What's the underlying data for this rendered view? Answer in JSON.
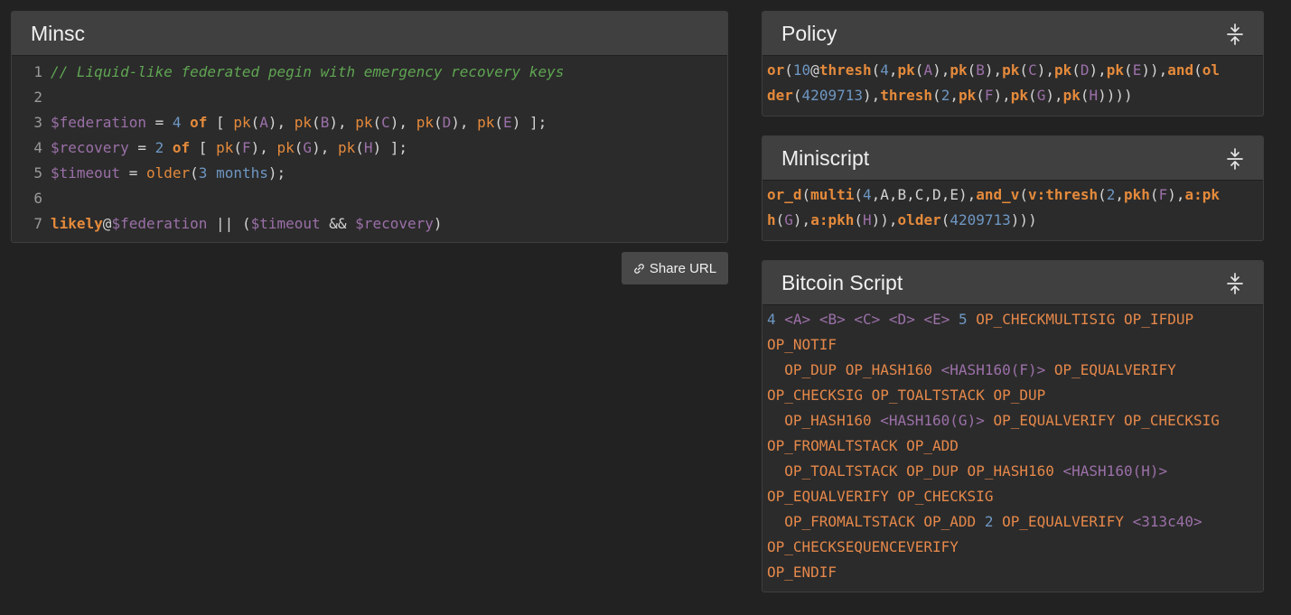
{
  "minsc": {
    "title": "Minsc",
    "lines": [
      [
        {
          "t": "// Liquid-like federated pegin with emergency recovery keys",
          "c": "c-com"
        }
      ],
      [],
      [
        {
          "t": "$federation",
          "c": "c-var"
        },
        {
          "t": " = ",
          "c": "c-punc"
        },
        {
          "t": "4",
          "c": "c-num"
        },
        {
          "t": " ",
          "c": "c-punc"
        },
        {
          "t": "of",
          "c": "c-kw"
        },
        {
          "t": " [ ",
          "c": "c-punc"
        },
        {
          "t": "pk",
          "c": "c-fn"
        },
        {
          "t": "(",
          "c": "c-punc"
        },
        {
          "t": "A",
          "c": "c-arg"
        },
        {
          "t": "), ",
          "c": "c-punc"
        },
        {
          "t": "pk",
          "c": "c-fn"
        },
        {
          "t": "(",
          "c": "c-punc"
        },
        {
          "t": "B",
          "c": "c-arg"
        },
        {
          "t": "), ",
          "c": "c-punc"
        },
        {
          "t": "pk",
          "c": "c-fn"
        },
        {
          "t": "(",
          "c": "c-punc"
        },
        {
          "t": "C",
          "c": "c-arg"
        },
        {
          "t": "), ",
          "c": "c-punc"
        },
        {
          "t": "pk",
          "c": "c-fn"
        },
        {
          "t": "(",
          "c": "c-punc"
        },
        {
          "t": "D",
          "c": "c-arg"
        },
        {
          "t": "), ",
          "c": "c-punc"
        },
        {
          "t": "pk",
          "c": "c-fn"
        },
        {
          "t": "(",
          "c": "c-punc"
        },
        {
          "t": "E",
          "c": "c-arg"
        },
        {
          "t": ") ];",
          "c": "c-punc"
        }
      ],
      [
        {
          "t": "$recovery",
          "c": "c-var"
        },
        {
          "t": " = ",
          "c": "c-punc"
        },
        {
          "t": "2",
          "c": "c-num"
        },
        {
          "t": " ",
          "c": "c-punc"
        },
        {
          "t": "of",
          "c": "c-kw"
        },
        {
          "t": " [ ",
          "c": "c-punc"
        },
        {
          "t": "pk",
          "c": "c-fn"
        },
        {
          "t": "(",
          "c": "c-punc"
        },
        {
          "t": "F",
          "c": "c-arg"
        },
        {
          "t": "), ",
          "c": "c-punc"
        },
        {
          "t": "pk",
          "c": "c-fn"
        },
        {
          "t": "(",
          "c": "c-punc"
        },
        {
          "t": "G",
          "c": "c-arg"
        },
        {
          "t": "), ",
          "c": "c-punc"
        },
        {
          "t": "pk",
          "c": "c-fn"
        },
        {
          "t": "(",
          "c": "c-punc"
        },
        {
          "t": "H",
          "c": "c-arg"
        },
        {
          "t": ") ];",
          "c": "c-punc"
        }
      ],
      [
        {
          "t": "$timeout",
          "c": "c-var"
        },
        {
          "t": " = ",
          "c": "c-punc"
        },
        {
          "t": "older",
          "c": "c-fn"
        },
        {
          "t": "(",
          "c": "c-punc"
        },
        {
          "t": "3",
          "c": "c-num"
        },
        {
          "t": " ",
          "c": "c-punc"
        },
        {
          "t": "months",
          "c": "c-num"
        },
        {
          "t": ");",
          "c": "c-punc"
        }
      ],
      [],
      [
        {
          "t": "likely",
          "c": "c-kw"
        },
        {
          "t": "@",
          "c": "c-punc"
        },
        {
          "t": "$federation",
          "c": "c-var"
        },
        {
          "t": " || (",
          "c": "c-punc"
        },
        {
          "t": "$timeout",
          "c": "c-var"
        },
        {
          "t": " && ",
          "c": "c-punc"
        },
        {
          "t": "$recovery",
          "c": "c-var"
        },
        {
          "t": ")",
          "c": "c-punc"
        }
      ]
    ]
  },
  "share_button": {
    "label": "Share URL"
  },
  "policy": {
    "title": "Policy",
    "lines": [
      [
        {
          "t": "or",
          "c": "c-fnb"
        },
        {
          "t": "(",
          "c": "c-punc"
        },
        {
          "t": "10",
          "c": "c-num"
        },
        {
          "t": "@",
          "c": "c-punc"
        },
        {
          "t": "thresh",
          "c": "c-fnb"
        },
        {
          "t": "(",
          "c": "c-punc"
        },
        {
          "t": "4",
          "c": "c-num"
        },
        {
          "t": ",",
          "c": "c-punc"
        },
        {
          "t": "pk",
          "c": "c-fnb"
        },
        {
          "t": "(",
          "c": "c-punc"
        },
        {
          "t": "A",
          "c": "c-arg"
        },
        {
          "t": "),",
          "c": "c-punc"
        },
        {
          "t": "pk",
          "c": "c-fnb"
        },
        {
          "t": "(",
          "c": "c-punc"
        },
        {
          "t": "B",
          "c": "c-arg"
        },
        {
          "t": "),",
          "c": "c-punc"
        },
        {
          "t": "pk",
          "c": "c-fnb"
        },
        {
          "t": "(",
          "c": "c-punc"
        },
        {
          "t": "C",
          "c": "c-arg"
        },
        {
          "t": "),",
          "c": "c-punc"
        },
        {
          "t": "pk",
          "c": "c-fnb"
        },
        {
          "t": "(",
          "c": "c-punc"
        },
        {
          "t": "D",
          "c": "c-arg"
        },
        {
          "t": "),",
          "c": "c-punc"
        },
        {
          "t": "pk",
          "c": "c-fnb"
        },
        {
          "t": "(",
          "c": "c-punc"
        },
        {
          "t": "E",
          "c": "c-arg"
        },
        {
          "t": ")),",
          "c": "c-punc"
        },
        {
          "t": "and",
          "c": "c-fnb"
        },
        {
          "t": "(",
          "c": "c-punc"
        },
        {
          "t": "ol",
          "c": "c-fnb"
        }
      ],
      [
        {
          "t": "der",
          "c": "c-fnb"
        },
        {
          "t": "(",
          "c": "c-punc"
        },
        {
          "t": "4209713",
          "c": "c-num"
        },
        {
          "t": "),",
          "c": "c-punc"
        },
        {
          "t": "thresh",
          "c": "c-fnb"
        },
        {
          "t": "(",
          "c": "c-punc"
        },
        {
          "t": "2",
          "c": "c-num"
        },
        {
          "t": ",",
          "c": "c-punc"
        },
        {
          "t": "pk",
          "c": "c-fnb"
        },
        {
          "t": "(",
          "c": "c-punc"
        },
        {
          "t": "F",
          "c": "c-arg"
        },
        {
          "t": "),",
          "c": "c-punc"
        },
        {
          "t": "pk",
          "c": "c-fnb"
        },
        {
          "t": "(",
          "c": "c-punc"
        },
        {
          "t": "G",
          "c": "c-arg"
        },
        {
          "t": "),",
          "c": "c-punc"
        },
        {
          "t": "pk",
          "c": "c-fnb"
        },
        {
          "t": "(",
          "c": "c-punc"
        },
        {
          "t": "H",
          "c": "c-arg"
        },
        {
          "t": "))))",
          "c": "c-punc"
        }
      ]
    ]
  },
  "miniscript": {
    "title": "Miniscript",
    "lines": [
      [
        {
          "t": "or_d",
          "c": "c-fnb"
        },
        {
          "t": "(",
          "c": "c-punc"
        },
        {
          "t": "multi",
          "c": "c-fnb"
        },
        {
          "t": "(",
          "c": "c-punc"
        },
        {
          "t": "4",
          "c": "c-num"
        },
        {
          "t": ",A,B,C,D,E),",
          "c": "c-punc"
        },
        {
          "t": "and_v",
          "c": "c-fnb"
        },
        {
          "t": "(",
          "c": "c-punc"
        },
        {
          "t": "v:thresh",
          "c": "c-fnb"
        },
        {
          "t": "(",
          "c": "c-punc"
        },
        {
          "t": "2",
          "c": "c-num"
        },
        {
          "t": ",",
          "c": "c-punc"
        },
        {
          "t": "pkh",
          "c": "c-fnb"
        },
        {
          "t": "(",
          "c": "c-punc"
        },
        {
          "t": "F",
          "c": "c-arg"
        },
        {
          "t": "),",
          "c": "c-punc"
        },
        {
          "t": "a:pk",
          "c": "c-fnb"
        }
      ],
      [
        {
          "t": "h",
          "c": "c-fnb"
        },
        {
          "t": "(",
          "c": "c-punc"
        },
        {
          "t": "G",
          "c": "c-arg"
        },
        {
          "t": "),",
          "c": "c-punc"
        },
        {
          "t": "a:pkh",
          "c": "c-fnb"
        },
        {
          "t": "(",
          "c": "c-punc"
        },
        {
          "t": "H",
          "c": "c-arg"
        },
        {
          "t": ")),",
          "c": "c-punc"
        },
        {
          "t": "older",
          "c": "c-fnb"
        },
        {
          "t": "(",
          "c": "c-punc"
        },
        {
          "t": "4209713",
          "c": "c-num"
        },
        {
          "t": ")))",
          "c": "c-punc"
        }
      ]
    ]
  },
  "bitcoin_script": {
    "title": "Bitcoin Script",
    "lines": [
      [
        {
          "t": "4",
          "c": "c-num"
        },
        {
          "t": " ",
          "c": "c-punc"
        },
        {
          "t": "<A>",
          "c": "c-ph"
        },
        {
          "t": " ",
          "c": "c-punc"
        },
        {
          "t": "<B>",
          "c": "c-ph"
        },
        {
          "t": " ",
          "c": "c-punc"
        },
        {
          "t": "<C>",
          "c": "c-ph"
        },
        {
          "t": " ",
          "c": "c-punc"
        },
        {
          "t": "<D>",
          "c": "c-ph"
        },
        {
          "t": " ",
          "c": "c-punc"
        },
        {
          "t": "<E>",
          "c": "c-ph"
        },
        {
          "t": " ",
          "c": "c-punc"
        },
        {
          "t": "5",
          "c": "c-num"
        },
        {
          "t": " OP_CHECKMULTISIG OP_IFDUP",
          "c": "c-opc"
        }
      ],
      [
        {
          "t": "OP_NOTIF",
          "c": "c-opc"
        }
      ],
      [
        {
          "t": "  OP_DUP OP_HASH160 ",
          "c": "c-opc"
        },
        {
          "t": "<HASH160(F)>",
          "c": "c-ph"
        },
        {
          "t": " OP_EQUALVERIFY",
          "c": "c-opc"
        }
      ],
      [
        {
          "t": "OP_CHECKSIG OP_TOALTSTACK OP_DUP",
          "c": "c-opc"
        }
      ],
      [
        {
          "t": "  OP_HASH160 ",
          "c": "c-opc"
        },
        {
          "t": "<HASH160(G)>",
          "c": "c-ph"
        },
        {
          "t": " OP_EQUALVERIFY OP_CHECKSIG",
          "c": "c-opc"
        }
      ],
      [
        {
          "t": "OP_FROMALTSTACK OP_ADD",
          "c": "c-opc"
        }
      ],
      [
        {
          "t": "  OP_TOALTSTACK OP_DUP OP_HASH160 ",
          "c": "c-opc"
        },
        {
          "t": "<HASH160(H)>",
          "c": "c-ph"
        }
      ],
      [
        {
          "t": "OP_EQUALVERIFY OP_CHECKSIG",
          "c": "c-opc"
        }
      ],
      [
        {
          "t": "  OP_FROMALTSTACK OP_ADD ",
          "c": "c-opc"
        },
        {
          "t": "2",
          "c": "c-num"
        },
        {
          "t": " OP_EQUALVERIFY ",
          "c": "c-opc"
        },
        {
          "t": "<313c40>",
          "c": "c-ph"
        }
      ],
      [
        {
          "t": "OP_CHECKSEQUENCEVERIFY",
          "c": "c-opc"
        }
      ],
      [
        {
          "t": "OP_ENDIF",
          "c": "c-opc"
        }
      ]
    ]
  },
  "icons": {
    "collapse": "collapse-icon",
    "link": "link-icon"
  }
}
